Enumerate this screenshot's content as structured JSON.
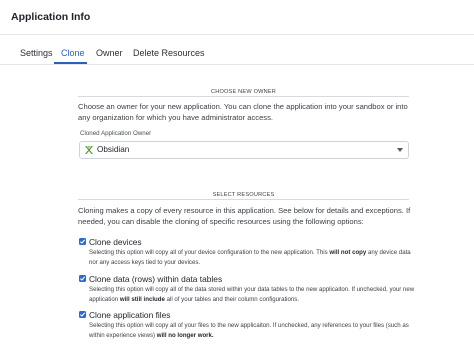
{
  "header": {
    "title": "Application Info"
  },
  "tabs": [
    {
      "label": "Settings",
      "active": false
    },
    {
      "label": "Clone",
      "active": true
    },
    {
      "label": "Owner",
      "active": false
    },
    {
      "label": "Delete Resources",
      "active": false
    }
  ],
  "owner_section": {
    "title": "CHOOSE NEW OWNER",
    "description": "Choose an owner for your new application. You can clone the application into your sandbox or into any organization for which you have administrator access.",
    "field_label": "Cloned Application Owner",
    "selected_owner": "Obsidian",
    "owner_icon": "cross-logo-icon"
  },
  "resources_section": {
    "title": "SELECT RESOURCES",
    "description": "Cloning makes a copy of every resource in this application. See below for details and exceptions. If needed, you can disable the cloning of specific resources using the following options:",
    "options": [
      {
        "label": "Clone devices",
        "checked": true,
        "desc_pre": "Selecting this option will copy all of your device configuration to the new application. This ",
        "desc_bold": "will not copy",
        "desc_post": " any device data nor any access keys tied to your devices."
      },
      {
        "label": "Clone data (rows) within data tables",
        "checked": true,
        "desc_pre": "Selecting this option will copy all of the data stored within your data tables to the new applicaiton. If unchecked, your new application ",
        "desc_bold": "will still include",
        "desc_post": " all of your tables and their column configurations."
      },
      {
        "label": "Clone application files",
        "checked": true,
        "desc_pre": "Selecting this option will copy all of your files to the new applicaiton. If unchecked, any references to your files (such as within experience views) ",
        "desc_bold": "will no longer work.",
        "desc_post": ""
      }
    ]
  },
  "colors": {
    "accent": "#2d5fb8",
    "checkbox": "#2d6bd1"
  }
}
